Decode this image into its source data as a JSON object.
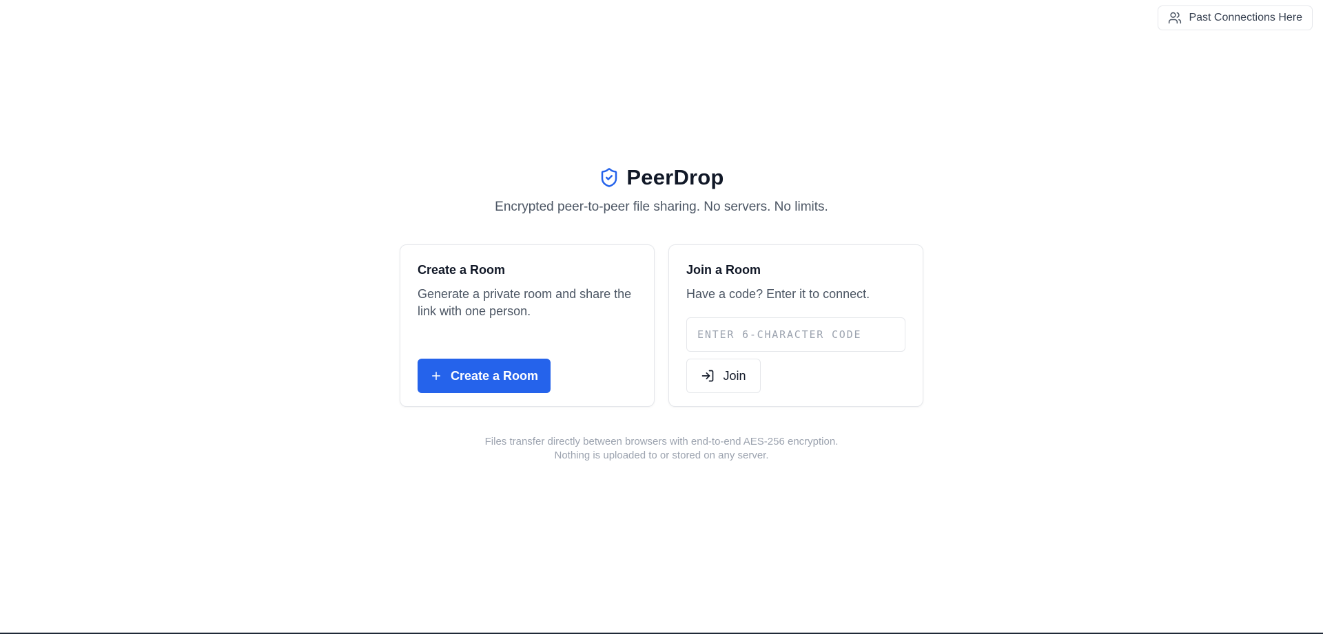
{
  "header": {
    "past_connections_label": "Past Connections Here",
    "past_connections_icon": "users-icon"
  },
  "brand": {
    "icon": "shield-check-icon",
    "title": "PeerDrop",
    "tagline": "Encrypted peer-to-peer file sharing. No servers. No limits."
  },
  "create_room": {
    "title": "Create a Room",
    "description": "Generate a private room and share the link with one person.",
    "button_label": "Create a Room",
    "button_icon": "plus-icon"
  },
  "join_room": {
    "title": "Join a Room",
    "description": "Have a code? Enter it to connect.",
    "code_value": "",
    "code_placeholder": "Enter 6-character code",
    "button_label": "Join",
    "button_icon": "log-in-icon"
  },
  "footer": {
    "line1": "Files transfer directly between browsers with end-to-end AES-256 encryption.",
    "line2": "Nothing is uploaded to or stored on any server."
  },
  "colors": {
    "accent": "#2563eb",
    "text": "#111827",
    "muted": "#4b5563",
    "subtle": "#9ca3af",
    "border": "#e5e7eb"
  }
}
